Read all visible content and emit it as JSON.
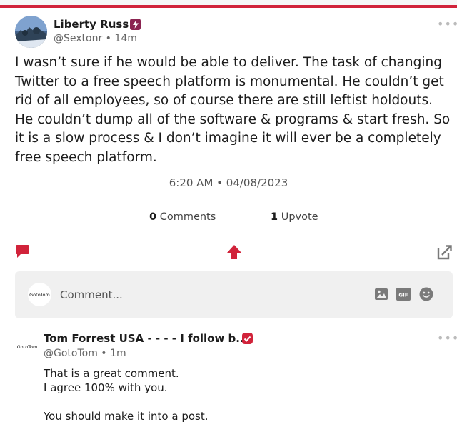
{
  "post": {
    "author": "Liberty Russ",
    "handle": "@Sextonr",
    "age": "14m",
    "text": "I wasn’t sure if he would be able to deliver. The task of changing Twitter to a free speech platform is monumental. He couldn’t get rid of all employees, so of course there are still leftist holdouts. He couldn’t dump all of the software & programs & start fresh. So it is a slow process & I don’t imagine it will ever be a completely free speech platform.",
    "timestamp": "6:20 AM",
    "date": "04/08/2023",
    "comments_count": "0",
    "comments_label": "Comments",
    "upvotes_count": "1",
    "upvotes_label": "Upvote"
  },
  "comment_box": {
    "avatar_label": "GotoTom",
    "placeholder": "Comment...",
    "gif_label": "GIF"
  },
  "reply": {
    "avatar_label": "GotoTom",
    "author": "Tom Forrest USA - - - - I follow b...",
    "handle": "@GotoTom",
    "age": "1m",
    "lines": [
      "That is a great comment.",
      "I agree 100% with you.",
      "",
      "You should make it into a post."
    ]
  },
  "icons": {
    "verified_badge": "shield-bolt-icon",
    "reply_badge": "shield-check-icon",
    "comment": "speech-bubble-icon",
    "upvote": "arrow-up-icon",
    "share": "share-arrow-icon",
    "image": "image-icon",
    "gif": "gif-icon",
    "emoji": "emoji-icon",
    "more": "more-dots-icon"
  },
  "colors": {
    "accent": "#d1233a",
    "badge_purple": "#8b2451",
    "icon_gray": "#7a7a7a"
  }
}
